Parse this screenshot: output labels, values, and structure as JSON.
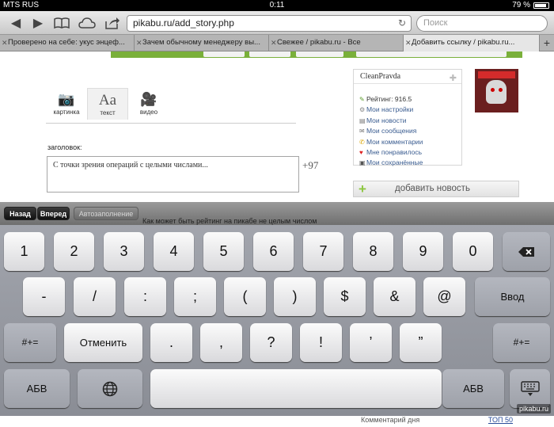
{
  "status": {
    "carrier": "MTS RUS",
    "time": "0:11",
    "battery": "79 %"
  },
  "toolbar": {
    "url": "pikabu.ru/add_story.php",
    "search_placeholder": "Поиск",
    "icons": [
      "back-arrow-icon",
      "forward-arrow-icon",
      "bookmarks-book-icon",
      "icloud-icon",
      "share-icon"
    ]
  },
  "tabs": [
    {
      "label": "Проверено на себе: укус энцеф...",
      "active": false
    },
    {
      "label": "Зачем обычному менеджеру вы...",
      "active": false
    },
    {
      "label": "Свежее / pikabu.ru - Все",
      "active": false
    },
    {
      "label": "Добавить ссылку / pikabu.ru...",
      "active": true
    }
  ],
  "page": {
    "media_tabs": [
      {
        "label": "картинка",
        "icon": "camera-icon",
        "glyph": "📷",
        "active": false
      },
      {
        "label": "текст",
        "icon": "text-aa-icon",
        "glyph": "Aa",
        "active": true
      },
      {
        "label": "видео",
        "icon": "video-camera-icon",
        "glyph": "🎥",
        "active": false
      }
    ],
    "title_label": "заголовок:",
    "title_value": "С точки зрения операций с целыми числами...",
    "title_counter": "+97",
    "user": {
      "name": "CleanPravda",
      "rating": "Рейтинг: 916.5",
      "links": [
        "Мои настройки",
        "Мои новости",
        "Мои сообщения",
        "Мои комментарии",
        "Мне понравилось",
        "Мои сохранённые"
      ]
    },
    "add_news": "добавить новость",
    "comment_of_day": "Комментарий дня",
    "top50": "ТОП 50",
    "text_behind": "Как может быть рейтинг на пикабе не целым числом"
  },
  "assistant": {
    "back": "Назад",
    "forward": "Вперед",
    "autofill": "Автозаполнение"
  },
  "keyboard": {
    "row1": [
      "1",
      "2",
      "3",
      "4",
      "5",
      "6",
      "7",
      "8",
      "9",
      "0"
    ],
    "row2": [
      "-",
      "/",
      ":",
      ";",
      "(",
      ")",
      "$",
      "&",
      "@"
    ],
    "enter": "Ввод",
    "symbols": "#+=",
    "undo": "Отменить",
    "row3": [
      ".",
      ",",
      "?",
      "!",
      "’",
      "”"
    ],
    "abc": "АБВ"
  },
  "watermark": "pikabu.ru"
}
